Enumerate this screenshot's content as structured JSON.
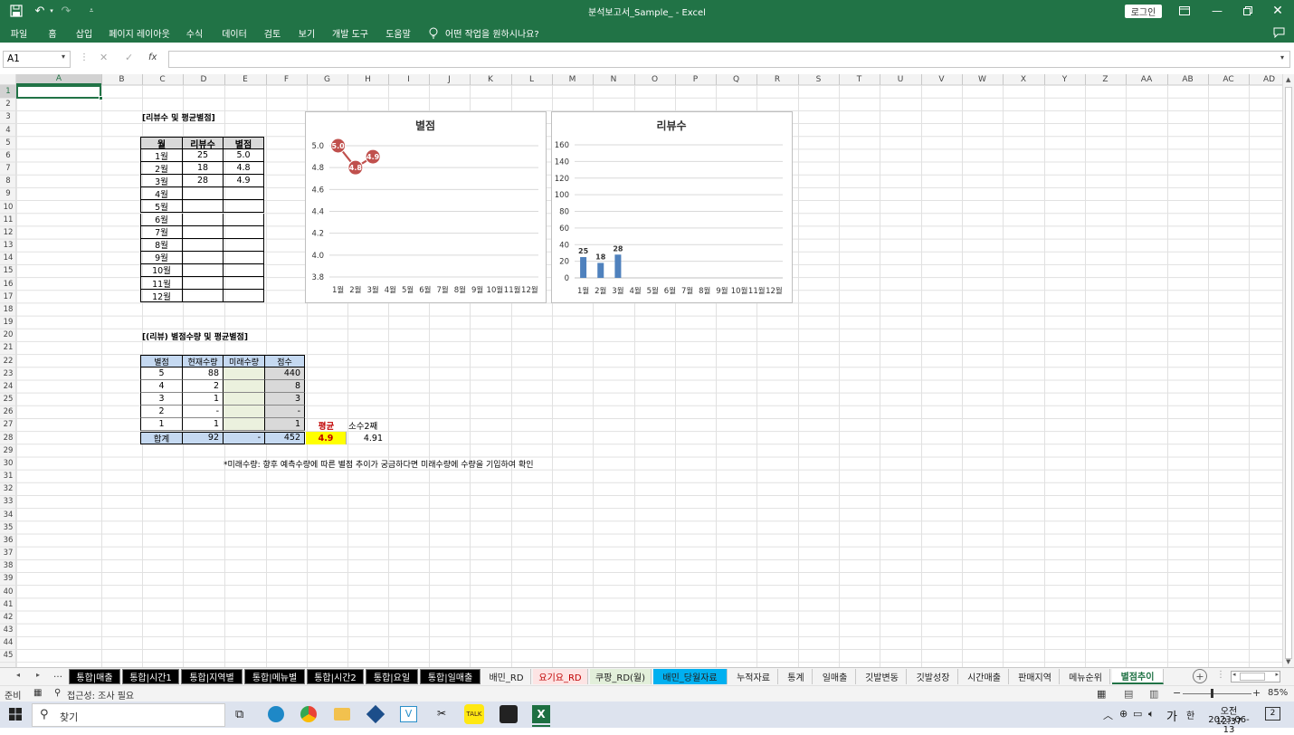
{
  "titlebar": {
    "title": "분석보고서_Sample_  -  Excel",
    "login": "로그인"
  },
  "ribbon": {
    "tabs": [
      "파일",
      "홈",
      "삽입",
      "페이지 레이아웃",
      "수식",
      "데이터",
      "검토",
      "보기",
      "개발 도구",
      "도움말"
    ],
    "tell_me": "어떤 작업을 원하시나요?"
  },
  "formula": {
    "namebox": "A1",
    "fx": "fx",
    "value": ""
  },
  "columns": [
    "A",
    "B",
    "C",
    "D",
    "E",
    "F",
    "G",
    "H",
    "I",
    "J",
    "K",
    "L",
    "M",
    "N",
    "O",
    "P",
    "Q",
    "R",
    "S",
    "T",
    "U",
    "V",
    "W",
    "X",
    "Y",
    "Z",
    "AA",
    "AB",
    "AC",
    "AD"
  ],
  "table1": {
    "heading": "[리뷰수 및 평균별점]",
    "headers": [
      "월",
      "리뷰수",
      "별점"
    ],
    "rows": [
      [
        "1월",
        "25",
        "5.0"
      ],
      [
        "2월",
        "18",
        "4.8"
      ],
      [
        "3월",
        "28",
        "4.9"
      ],
      [
        "4월",
        "",
        ""
      ],
      [
        "5월",
        "",
        ""
      ],
      [
        "6월",
        "",
        ""
      ],
      [
        "7월",
        "",
        ""
      ],
      [
        "8월",
        "",
        ""
      ],
      [
        "9월",
        "",
        ""
      ],
      [
        "10월",
        "",
        ""
      ],
      [
        "11월",
        "",
        ""
      ],
      [
        "12월",
        "",
        ""
      ]
    ]
  },
  "table2": {
    "heading": "[(리뷰) 별점수량 및 평균별점]",
    "headers": [
      "별점",
      "현재수량",
      "미래수량",
      "점수"
    ],
    "rows": [
      [
        "5",
        "88",
        "",
        "440"
      ],
      [
        "4",
        "2",
        "",
        "8"
      ],
      [
        "3",
        "1",
        "",
        "3"
      ],
      [
        "2",
        "-",
        "",
        "-"
      ],
      [
        "1",
        "1",
        "",
        "1"
      ]
    ],
    "total": [
      "합계",
      "92",
      "-",
      "452"
    ],
    "avg_label": "평균",
    "avg_value": "4.9",
    "dec_label": "소수2째",
    "dec_value": "4.91",
    "note": "*미래수량: 향후 예측수량에 따른 별점 추이가 궁금하다면 미래수량에 수량을 기입하여 확인"
  },
  "chart_data": [
    {
      "type": "line",
      "title": "별점",
      "categories": [
        "1월",
        "2월",
        "3월",
        "4월",
        "5월",
        "6월",
        "7월",
        "8월",
        "9월",
        "10월",
        "11월",
        "12월"
      ],
      "values": [
        5.0,
        4.8,
        4.9,
        null,
        null,
        null,
        null,
        null,
        null,
        null,
        null,
        null
      ],
      "ylim": [
        3.8,
        5.0
      ],
      "yticks": [
        "3.8",
        "4.0",
        "4.2",
        "4.4",
        "4.6",
        "4.8",
        "5.0"
      ],
      "data_labels": [
        "5.0",
        "4.8",
        "4.9"
      ],
      "color": "#c0504d"
    },
    {
      "type": "bar",
      "title": "리뷰수",
      "categories": [
        "1월",
        "2월",
        "3월",
        "4월",
        "5월",
        "6월",
        "7월",
        "8월",
        "9월",
        "10월",
        "11월",
        "12월"
      ],
      "values": [
        25,
        18,
        28,
        null,
        null,
        null,
        null,
        null,
        null,
        null,
        null,
        null
      ],
      "ylim": [
        0,
        160
      ],
      "yticks": [
        "0",
        "20",
        "40",
        "60",
        "80",
        "100",
        "120",
        "140",
        "160"
      ],
      "data_labels": [
        "25",
        "18",
        "28"
      ],
      "color": "#4f81bd"
    }
  ],
  "sheets": [
    "통합|매출",
    "통합|시간1",
    "통합|지역별",
    "통합|메뉴별",
    "통합|시간2",
    "통합|요일",
    "통합|일매출",
    "배민_RD",
    "요기요_RD",
    "쿠팡_RD(월)",
    "배민_당월자료",
    "누적자료",
    "통계",
    "일매출",
    "깃발변동",
    "깃발성장",
    "시간매출",
    "판매지역",
    "메뉴순위",
    "별점추이"
  ],
  "status": {
    "ready": "준비",
    "accessibility": "접근성: 조사 필요",
    "zoom": "85%"
  },
  "taskbar": {
    "search": "찾기",
    "time": "오전 12:37",
    "date": "2023-06-13",
    "ime": "가",
    "notif": "2"
  }
}
